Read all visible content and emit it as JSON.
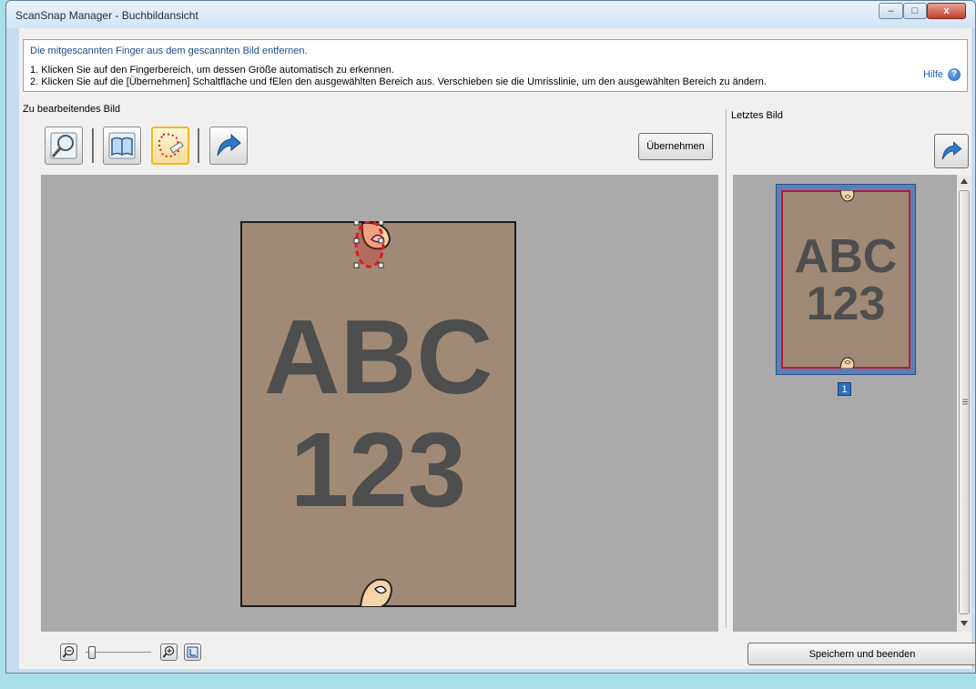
{
  "window": {
    "title": "ScanSnap Manager - Buchbildansicht"
  },
  "window_controls": {
    "minimize": "–",
    "maximize": "□",
    "close": "x"
  },
  "info": {
    "header": "Die mitgescannten Finger aus dem gescannten Bild entfernen.",
    "line1": "1. Klicken Sie auf den Fingerbereich, um dessen Größe automatisch zu erkennen.",
    "line2": "2. Klicken Sie auf die [Übernehmen] Schaltfläche und fElen den ausgewählten Bereich aus. Verschieben sie die Umrisslinie, um den ausgewählten Bereich zu ändern.",
    "help_label": "Hilfe",
    "help_icon": "?"
  },
  "edit_section": {
    "label": "Zu bearbeitendes Bild",
    "apply_label": "Übernehmen",
    "tools": [
      "magnifier-icon",
      "book-icon",
      "finger-removal-icon",
      "undo-icon"
    ],
    "active_tool": "finger-removal-icon"
  },
  "preview": {
    "line1": "ABC",
    "line2": "123"
  },
  "last_section": {
    "label": "Letztes Bild",
    "thumb_line1": "ABC",
    "thumb_line2": "123",
    "page_number": "1"
  },
  "footer": {
    "save_label": "Speichern und beenden",
    "zoom_level": 0.1
  },
  "colors": {
    "page": "#a08a75",
    "canvas": "#a9aaa9",
    "selection": "#e21b1b",
    "highlight": "#f2b81c",
    "thumb_border": "#2f6dbd"
  }
}
